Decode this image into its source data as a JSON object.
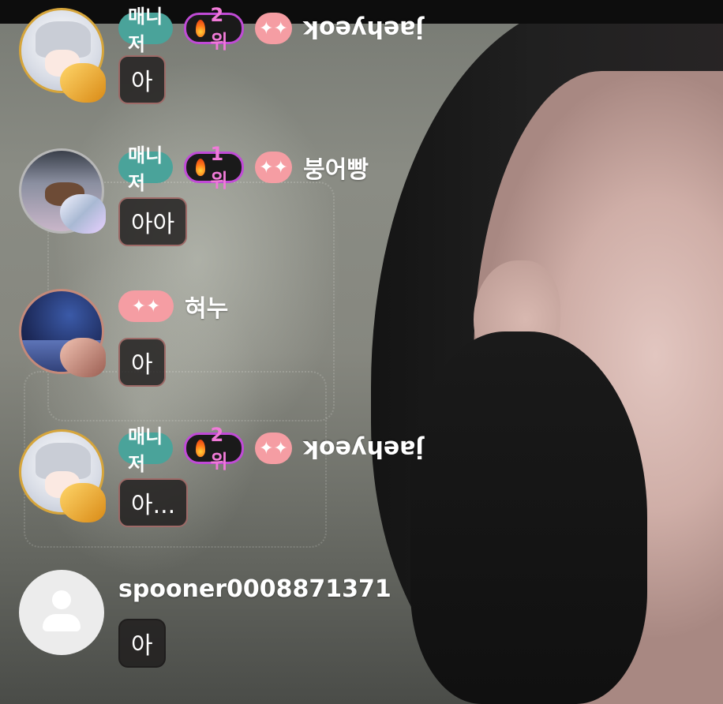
{
  "colors": {
    "manager_badge": "#4aa39a",
    "rank_border": "#c04bd6",
    "rank_text": "#f07ad8",
    "sparkle_badge": "#f59da3",
    "bubble_bg": "#1e1c1c"
  },
  "messages": [
    {
      "username": "jaehyeok",
      "username_upside_down": true,
      "manager_label": "매니저",
      "rank": "2위",
      "sparkle": "✦✦",
      "text": "아",
      "avatar_icon": "anime-avatar-gold-wing-icon"
    },
    {
      "username": "붕어빵",
      "manager_label": "매니저",
      "rank": "1위",
      "sparkle": "✦✦",
      "text": "아아",
      "avatar_icon": "photo-avatar-silver-wing-icon"
    },
    {
      "username": "혀누",
      "sparkle": "✦✦",
      "text": "아",
      "avatar_icon": "night-sky-avatar-bronze-wing-icon"
    },
    {
      "username": "jaehyeok",
      "username_upside_down": true,
      "manager_label": "매니저",
      "rank": "2위",
      "sparkle": "✦✦",
      "text": "아...",
      "avatar_icon": "anime-avatar-gold-wing-icon"
    },
    {
      "username": "spooner0008871371",
      "text": "아",
      "avatar_icon": "default-person-icon"
    }
  ]
}
